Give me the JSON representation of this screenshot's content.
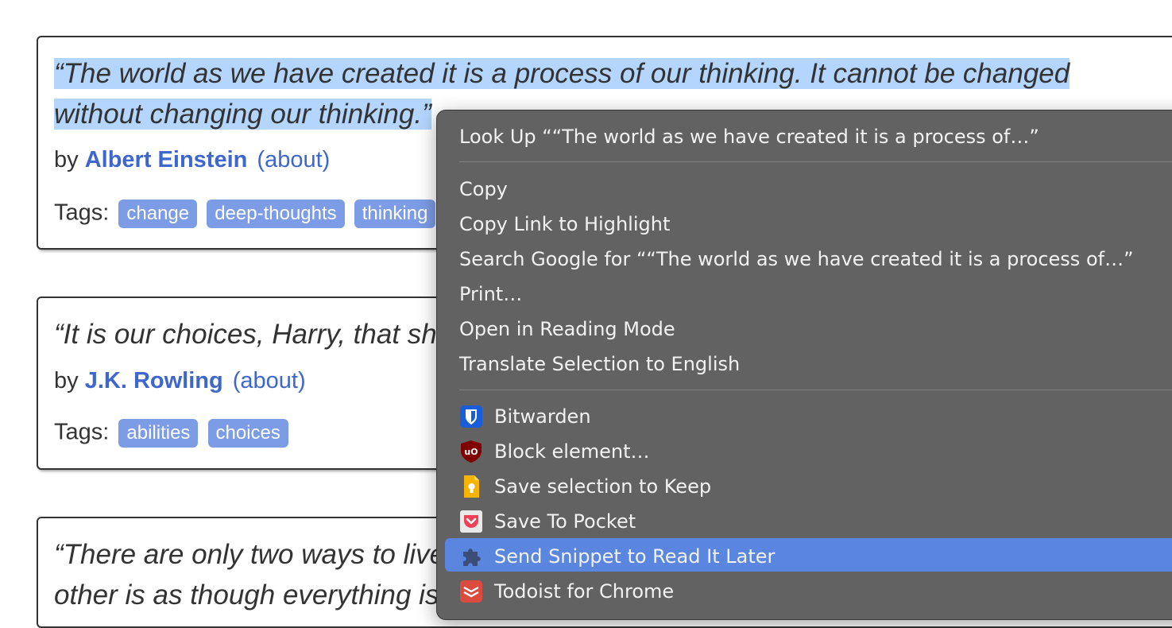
{
  "quotes": [
    {
      "text_line1": "“The world as we have created it is a process of our thinking. It cannot be changed",
      "text_line2": "without changing our thinking.”",
      "by": "by",
      "author": "Albert Einstein",
      "about": "(about)",
      "tags_label": "Tags:",
      "tags": [
        "change",
        "deep-thoughts",
        "thinking"
      ]
    },
    {
      "text_line1": "“It is our choices, Harry, that show what we truly are, far more than our abilities.”",
      "by": "by",
      "author": "J.K. Rowling",
      "about": "(about)",
      "tags_label": "Tags:",
      "tags": [
        "abilities",
        "choices"
      ]
    },
    {
      "text_line1": "“There are only two ways to live your life. One is as though nothing is a miracle. The",
      "text_line2": "other is as though everything is a miracle.”"
    }
  ],
  "context_menu": {
    "look_up": "Look Up ““The world as we have created it is a process of…”",
    "copy": "Copy",
    "copy_link": "Copy Link to Highlight",
    "search_google": "Search Google for ““The world as we have created it is a process of…”",
    "print": "Print…",
    "reading_mode": "Open in Reading Mode",
    "translate": "Translate Selection to English",
    "extensions": [
      {
        "label": "Bitwarden",
        "icon": "bitwarden-icon",
        "has_submenu": true
      },
      {
        "label": "Block element…",
        "icon": "ublock-icon",
        "has_submenu": false
      },
      {
        "label": "Save selection to Keep",
        "icon": "keep-icon",
        "has_submenu": false
      },
      {
        "label": "Save To Pocket",
        "icon": "pocket-icon",
        "has_submenu": false
      },
      {
        "label": "Send Snippet to Read It Later",
        "icon": "puzzle-icon",
        "has_submenu": false,
        "highlighted": true
      },
      {
        "label": "Todoist for Chrome",
        "icon": "todoist-icon",
        "has_submenu": true
      }
    ]
  },
  "colors": {
    "selection": "#b4d5fe",
    "author_link": "#3d66cf",
    "tag_bg": "#7c9ce6",
    "menu_bg": "#626262",
    "menu_highlight": "#5a86e0"
  }
}
